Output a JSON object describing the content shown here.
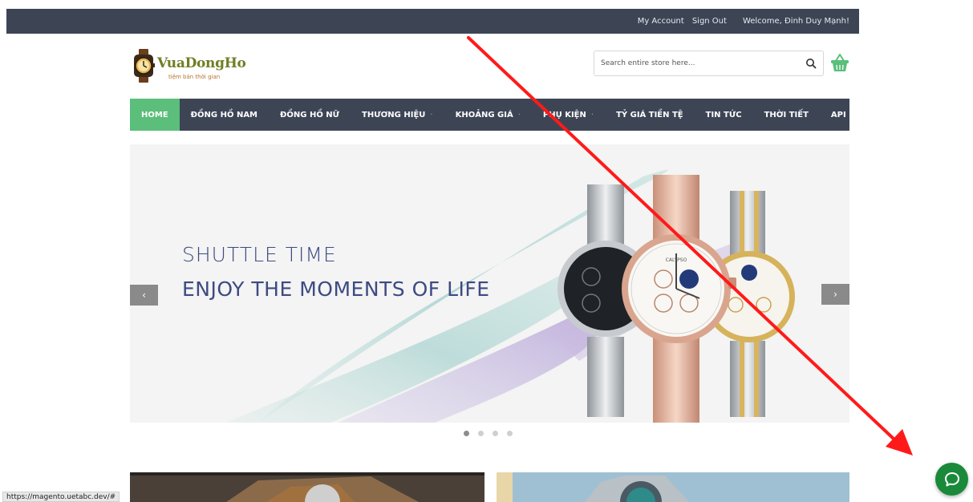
{
  "topbar": {
    "my_account": "My Account",
    "sign_out": "Sign Out",
    "welcome": "Welcome, Đinh Duy Mạnh!"
  },
  "logo": {
    "brand": "VuaDongHo",
    "tagline": "tiệm bán thời gian"
  },
  "search": {
    "placeholder": "Search entire store here...",
    "icon": "search-icon"
  },
  "cart": {
    "icon": "basket-icon",
    "color": "#5bbe7b"
  },
  "nav": {
    "items": [
      {
        "label": "HOME",
        "active": true,
        "dropdown": false
      },
      {
        "label": "ĐỒNG HỒ NAM",
        "active": false,
        "dropdown": false
      },
      {
        "label": "ĐỒNG HỒ NỮ",
        "active": false,
        "dropdown": false
      },
      {
        "label": "THƯƠNG HIỆU",
        "active": false,
        "dropdown": true
      },
      {
        "label": "KHOẢNG GIÁ",
        "active": false,
        "dropdown": true
      },
      {
        "label": "PHỤ KIỆN",
        "active": false,
        "dropdown": true
      },
      {
        "label": "TỶ GIÁ TIỀN TỆ",
        "active": false,
        "dropdown": false
      },
      {
        "label": "TIN TỨC",
        "active": false,
        "dropdown": false
      },
      {
        "label": "THỜI TIẾT",
        "active": false,
        "dropdown": false
      },
      {
        "label": "API",
        "active": false,
        "dropdown": false
      }
    ],
    "dropdown_glyph": "·",
    "bg_color": "#3d4555",
    "active_color": "#5bbe7b"
  },
  "banner": {
    "line1": "SHUTTLE TIME",
    "line2": "ENJOY THE MOMENTS OF LIFE",
    "prev_glyph": "‹",
    "next_glyph": "›",
    "watch_brand": "CALYPSO",
    "text_color": "#3e4a82"
  },
  "slider": {
    "count": 4,
    "active_index": 0
  },
  "status": {
    "url": "https://magento.uetabc.dev/#"
  },
  "chat": {
    "icon": "chat-bubble-icon",
    "color": "#1a8a3a"
  },
  "annotation": {
    "type": "red-arrow",
    "color": "#ff1a1a"
  }
}
